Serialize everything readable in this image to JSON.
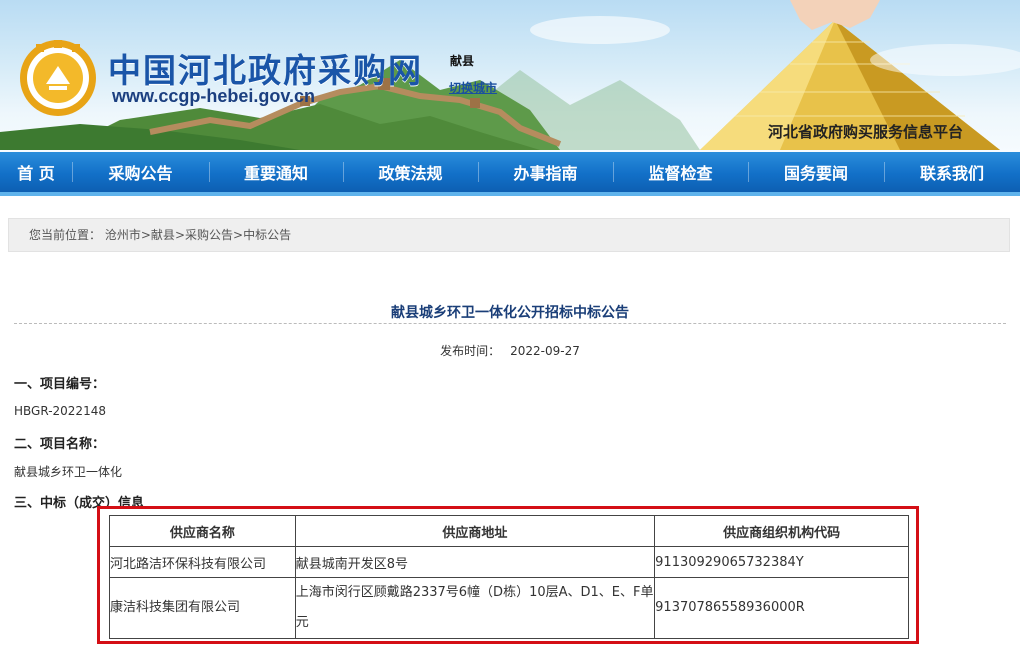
{
  "header": {
    "site_name": "中国河北政府采购网",
    "site_url": "www.ccgp-hebei.gov.cn",
    "city": "献县",
    "switch_city": "切换城市",
    "platform_text": "河北省政府购买服务信息平台"
  },
  "nav": {
    "items": [
      "首 页",
      "采购公告",
      "重要通知",
      "政策法规",
      "办事指南",
      "监督检查",
      "国务要闻",
      "联系我们"
    ]
  },
  "breadcrumb": {
    "label": "您当前位置：",
    "items": [
      "沧州市",
      "献县",
      "采购公告",
      "中标公告"
    ],
    "separator": ">"
  },
  "article": {
    "title": "献县城乡环卫一体化公开招标中标公告",
    "publish_label": "发布时间：",
    "publish_date": "2022-09-27",
    "section1_title": "一、项目编号：",
    "section1_value": "HBGR-2022148",
    "section2_title": "二、项目名称：",
    "section2_value": "献县城乡环卫一体化",
    "section3_title": "三、中标（成交）信息"
  },
  "table": {
    "headers": [
      "供应商名称",
      "供应商地址",
      "供应商组织机构代码"
    ],
    "rows": [
      [
        "河北路洁环保科技有限公司",
        "献县城南开发区8号",
        "91130929065732384Y"
      ],
      [
        "康洁科技集团有限公司",
        "上海市闵行区顾戴路2337号6幢（D栋）10层A、D1、E、F单元",
        "91370786558936000R"
      ]
    ]
  },
  "colors": {
    "nav_blue": "#1270c8",
    "title_blue": "#1a3e78",
    "highlight_red": "#d40f15",
    "site_name_blue": "#1a55a8"
  }
}
